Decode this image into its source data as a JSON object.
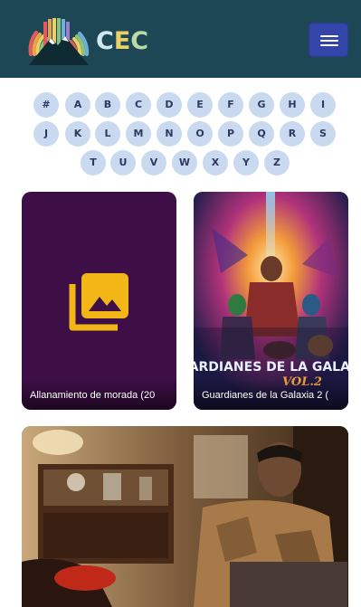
{
  "header": {
    "logo_text": [
      "C",
      "E",
      "C"
    ],
    "menu_icon": "hamburger-icon"
  },
  "alphabet": {
    "rows": [
      [
        "#",
        "A",
        "B",
        "C",
        "D",
        "E",
        "F",
        "G",
        "H",
        "I"
      ],
      [
        "J",
        "K",
        "L",
        "M",
        "N",
        "O",
        "P",
        "Q",
        "R",
        "S"
      ],
      [
        "T",
        "U",
        "V",
        "W",
        "X",
        "Y",
        "Z"
      ]
    ]
  },
  "cards": [
    {
      "title": "Allanamiento de morada (20",
      "image": "image-placeholder-icon"
    },
    {
      "title": "Guardianes de la Galaxia 2 (",
      "poster_title": "GUARDIANES DE LA GALAXIA",
      "poster_vol": "VOL.2"
    },
    {
      "title": ""
    }
  ],
  "colors": {
    "header_bg": "#1e4756",
    "menu_button": "#3345a8",
    "letter_bg": "#c9d9f0",
    "letter_text": "#2d3a60",
    "card_purple": "#3d0f46",
    "icon_yellow": "#f2b617"
  }
}
